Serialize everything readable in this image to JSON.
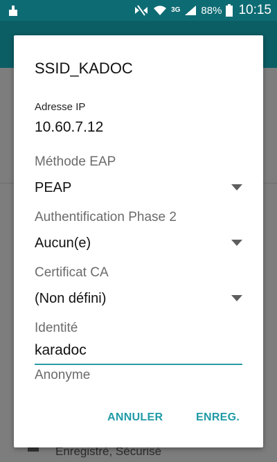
{
  "status_bar": {
    "icons": [
      "usb-icon",
      "mute-icon",
      "wifi-icon",
      "network-3g-icon",
      "signal-icon",
      "battery-icon"
    ],
    "network_type": "3G",
    "battery_percent": "88%",
    "time": "10:15"
  },
  "background": {
    "list_item_status": "Enregistré, Sécurisé"
  },
  "dialog": {
    "title": "SSID_KADOC",
    "ip_label": "Adresse IP",
    "ip_value": "10.60.7.12",
    "eap_method": {
      "label": "Méthode EAP",
      "value": "PEAP"
    },
    "phase2_auth": {
      "label": "Authentification Phase 2",
      "value": "Aucun(e)"
    },
    "ca_certificate": {
      "label": "Certificat CA",
      "value": "(Non défini)"
    },
    "identity": {
      "label": "Identité",
      "value": "karadoc"
    },
    "anonymous_identity": {
      "label": "Anonyme"
    },
    "buttons": {
      "cancel": "ANNULER",
      "save": "ENREG."
    }
  },
  "colors": {
    "status_bar": "#0d6b73",
    "app_bar": "#0b5e64",
    "accent": "#1f9aa6"
  }
}
